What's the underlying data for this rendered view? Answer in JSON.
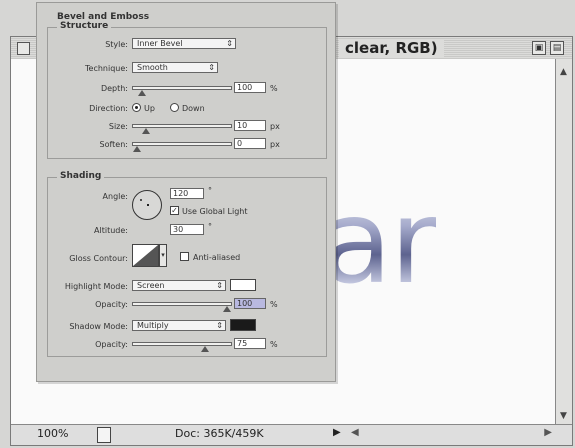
{
  "document": {
    "title": "clear, RGB)",
    "canvas_text": "ar",
    "zoom": "100%",
    "doc_size": "Doc: 365K/459K"
  },
  "dialog": {
    "title": "Bevel and Emboss",
    "structure": {
      "heading": "Structure",
      "style_label": "Style:",
      "style_value": "Inner Bevel",
      "technique_label": "Technique:",
      "technique_value": "Smooth",
      "depth_label": "Depth:",
      "depth_value": "100",
      "depth_unit": "%",
      "depth_level": 0.05,
      "direction_label": "Direction:",
      "direction_up": "Up",
      "direction_down": "Down",
      "direction_selected": "Up",
      "size_label": "Size:",
      "size_value": "10",
      "size_unit": "px",
      "size_level": 0.1,
      "soften_label": "Soften:",
      "soften_value": "0",
      "soften_unit": "px",
      "soften_level": 0.0
    },
    "shading": {
      "heading": "Shading",
      "angle_label": "Angle:",
      "angle_value": "120",
      "angle_unit": "°",
      "global_light_label": "Use Global Light",
      "global_light_checked": true,
      "altitude_label": "Altitude:",
      "altitude_value": "30",
      "altitude_unit": "°",
      "gloss_label": "Gloss Contour:",
      "anti_aliased_label": "Anti-aliased",
      "anti_aliased_checked": false,
      "highlight_mode_label": "Highlight Mode:",
      "highlight_mode_value": "Screen",
      "highlight_color": "#ffffff",
      "highlight_opacity_label": "Opacity:",
      "highlight_opacity_value": "100",
      "highlight_opacity_unit": "%",
      "highlight_opacity_level": 1.0,
      "shadow_mode_label": "Shadow Mode:",
      "shadow_mode_value": "Multiply",
      "shadow_color": "#1a1a1a",
      "shadow_opacity_label": "Opacity:",
      "shadow_opacity_value": "75",
      "shadow_opacity_unit": "%",
      "shadow_opacity_level": 0.75
    }
  },
  "icons": {
    "close": "close-box-icon",
    "zoom_box": "zoom-box-icon",
    "collapse_box": "collapse-box-icon",
    "play": "play-icon",
    "scroll_up": "arrow-up-icon",
    "scroll_down": "arrow-down-icon"
  }
}
